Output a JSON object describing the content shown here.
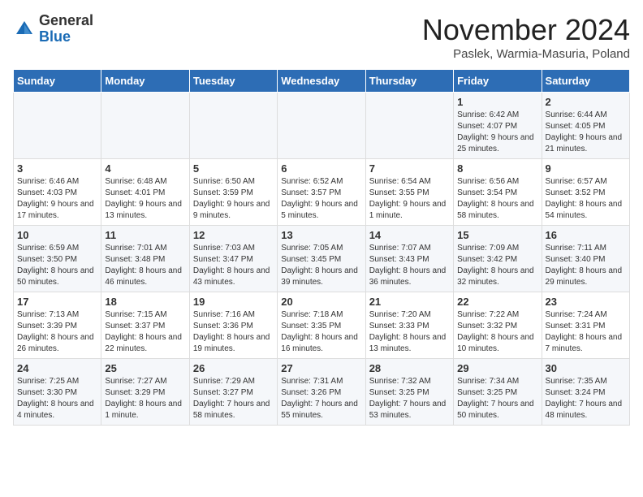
{
  "logo": {
    "general": "General",
    "blue": "Blue"
  },
  "title": "November 2024",
  "subtitle": "Paslek, Warmia-Masuria, Poland",
  "days_of_week": [
    "Sunday",
    "Monday",
    "Tuesday",
    "Wednesday",
    "Thursday",
    "Friday",
    "Saturday"
  ],
  "weeks": [
    [
      {
        "day": "",
        "info": ""
      },
      {
        "day": "",
        "info": ""
      },
      {
        "day": "",
        "info": ""
      },
      {
        "day": "",
        "info": ""
      },
      {
        "day": "",
        "info": ""
      },
      {
        "day": "1",
        "info": "Sunrise: 6:42 AM\nSunset: 4:07 PM\nDaylight: 9 hours and 25 minutes."
      },
      {
        "day": "2",
        "info": "Sunrise: 6:44 AM\nSunset: 4:05 PM\nDaylight: 9 hours and 21 minutes."
      }
    ],
    [
      {
        "day": "3",
        "info": "Sunrise: 6:46 AM\nSunset: 4:03 PM\nDaylight: 9 hours and 17 minutes."
      },
      {
        "day": "4",
        "info": "Sunrise: 6:48 AM\nSunset: 4:01 PM\nDaylight: 9 hours and 13 minutes."
      },
      {
        "day": "5",
        "info": "Sunrise: 6:50 AM\nSunset: 3:59 PM\nDaylight: 9 hours and 9 minutes."
      },
      {
        "day": "6",
        "info": "Sunrise: 6:52 AM\nSunset: 3:57 PM\nDaylight: 9 hours and 5 minutes."
      },
      {
        "day": "7",
        "info": "Sunrise: 6:54 AM\nSunset: 3:55 PM\nDaylight: 9 hours and 1 minute."
      },
      {
        "day": "8",
        "info": "Sunrise: 6:56 AM\nSunset: 3:54 PM\nDaylight: 8 hours and 58 minutes."
      },
      {
        "day": "9",
        "info": "Sunrise: 6:57 AM\nSunset: 3:52 PM\nDaylight: 8 hours and 54 minutes."
      }
    ],
    [
      {
        "day": "10",
        "info": "Sunrise: 6:59 AM\nSunset: 3:50 PM\nDaylight: 8 hours and 50 minutes."
      },
      {
        "day": "11",
        "info": "Sunrise: 7:01 AM\nSunset: 3:48 PM\nDaylight: 8 hours and 46 minutes."
      },
      {
        "day": "12",
        "info": "Sunrise: 7:03 AM\nSunset: 3:47 PM\nDaylight: 8 hours and 43 minutes."
      },
      {
        "day": "13",
        "info": "Sunrise: 7:05 AM\nSunset: 3:45 PM\nDaylight: 8 hours and 39 minutes."
      },
      {
        "day": "14",
        "info": "Sunrise: 7:07 AM\nSunset: 3:43 PM\nDaylight: 8 hours and 36 minutes."
      },
      {
        "day": "15",
        "info": "Sunrise: 7:09 AM\nSunset: 3:42 PM\nDaylight: 8 hours and 32 minutes."
      },
      {
        "day": "16",
        "info": "Sunrise: 7:11 AM\nSunset: 3:40 PM\nDaylight: 8 hours and 29 minutes."
      }
    ],
    [
      {
        "day": "17",
        "info": "Sunrise: 7:13 AM\nSunset: 3:39 PM\nDaylight: 8 hours and 26 minutes."
      },
      {
        "day": "18",
        "info": "Sunrise: 7:15 AM\nSunset: 3:37 PM\nDaylight: 8 hours and 22 minutes."
      },
      {
        "day": "19",
        "info": "Sunrise: 7:16 AM\nSunset: 3:36 PM\nDaylight: 8 hours and 19 minutes."
      },
      {
        "day": "20",
        "info": "Sunrise: 7:18 AM\nSunset: 3:35 PM\nDaylight: 8 hours and 16 minutes."
      },
      {
        "day": "21",
        "info": "Sunrise: 7:20 AM\nSunset: 3:33 PM\nDaylight: 8 hours and 13 minutes."
      },
      {
        "day": "22",
        "info": "Sunrise: 7:22 AM\nSunset: 3:32 PM\nDaylight: 8 hours and 10 minutes."
      },
      {
        "day": "23",
        "info": "Sunrise: 7:24 AM\nSunset: 3:31 PM\nDaylight: 8 hours and 7 minutes."
      }
    ],
    [
      {
        "day": "24",
        "info": "Sunrise: 7:25 AM\nSunset: 3:30 PM\nDaylight: 8 hours and 4 minutes."
      },
      {
        "day": "25",
        "info": "Sunrise: 7:27 AM\nSunset: 3:29 PM\nDaylight: 8 hours and 1 minute."
      },
      {
        "day": "26",
        "info": "Sunrise: 7:29 AM\nSunset: 3:27 PM\nDaylight: 7 hours and 58 minutes."
      },
      {
        "day": "27",
        "info": "Sunrise: 7:31 AM\nSunset: 3:26 PM\nDaylight: 7 hours and 55 minutes."
      },
      {
        "day": "28",
        "info": "Sunrise: 7:32 AM\nSunset: 3:25 PM\nDaylight: 7 hours and 53 minutes."
      },
      {
        "day": "29",
        "info": "Sunrise: 7:34 AM\nSunset: 3:25 PM\nDaylight: 7 hours and 50 minutes."
      },
      {
        "day": "30",
        "info": "Sunrise: 7:35 AM\nSunset: 3:24 PM\nDaylight: 7 hours and 48 minutes."
      }
    ]
  ]
}
